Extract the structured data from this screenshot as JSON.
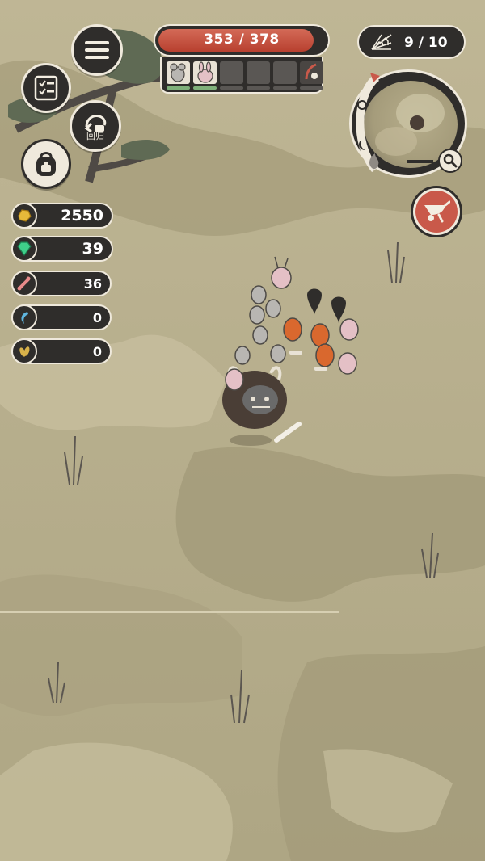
{
  "hud": {
    "health_text": "353 / 378",
    "health_fraction": 0.934,
    "party_slots": [
      {
        "state": "filled",
        "creature": "rat"
      },
      {
        "state": "filled",
        "creature": "rabbit"
      },
      {
        "state": "empty"
      },
      {
        "state": "empty"
      },
      {
        "state": "empty"
      },
      {
        "state": "special"
      }
    ],
    "web_counter": "9 / 10",
    "return_label": "回归"
  },
  "resources": [
    {
      "name": "gold",
      "icon": "gold-nugget-icon",
      "value": "2550"
    },
    {
      "name": "gems",
      "icon": "green-gem-icon",
      "value": "39"
    },
    {
      "name": "bones",
      "icon": "bone-icon",
      "value": "36"
    },
    {
      "name": "claws",
      "icon": "blue-claw-icon",
      "value": "0"
    },
    {
      "name": "seeds",
      "icon": "seed-icon",
      "value": "0"
    }
  ],
  "colors": {
    "panel": "#2f2d2b",
    "panel_border": "#efe9dc",
    "health_red": "#c0473a",
    "cart_red": "#c9594a",
    "ground": "#b9b08f"
  }
}
